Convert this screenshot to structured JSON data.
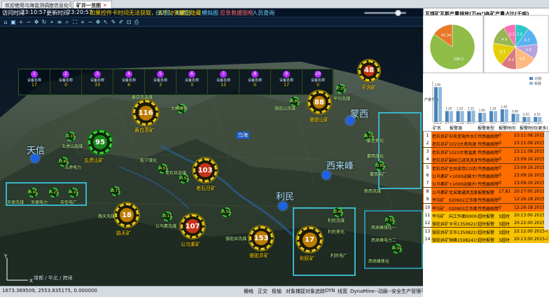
{
  "tabs": [
    {
      "label": "欢迎使用乌海监测调度信息化平台",
      "active": false
    },
    {
      "label": "矿井一览图",
      "active": true
    }
  ],
  "header": {
    "visit_time_label": "访问时间",
    "visit_time": "23:10:57",
    "update_time_label": "更新时间",
    "update_time": "23:20:57",
    "notice": "如果控件卡时间无法获取，请手动安装",
    "install_hint": "(32位、64位)",
    "hide_label": "!按钮隐藏",
    "link1": "模拟图",
    "link2": "应急救援图框",
    "personnel": "人员查询"
  },
  "toolbar_icons": [
    "home-icon",
    "save-icon",
    "zoom-in-icon",
    "zoom-out-icon",
    "pan-icon",
    "refresh-icon",
    "measure-icon",
    "layer-icon",
    "search-icon",
    "fullscreen-icon",
    "zoom-in-icon",
    "zoom-out-icon",
    "pan-icon",
    "select-icon",
    "tool-icon",
    "edit-icon",
    "zoom-box-icon",
    "print-icon"
  ],
  "top_strip": [
    {
      "pin": "1",
      "name": "设备名称",
      "value": "17"
    },
    {
      "pin": "2",
      "name": "设备名称",
      "value": "0"
    },
    {
      "pin": "3",
      "name": "设备名称",
      "value": "33"
    },
    {
      "pin": "4",
      "name": "设备名称",
      "value": "6"
    },
    {
      "pin": "5",
      "name": "设备名称",
      "value": "3"
    },
    {
      "pin": "6",
      "name": "设备名称",
      "value": "3"
    },
    {
      "pin": "7",
      "name": "设备名称",
      "value": "13"
    },
    {
      "pin": "8",
      "name": "设备名称",
      "value": "0"
    },
    {
      "pin": "9",
      "name": "设备名称",
      "value": "17"
    },
    {
      "pin": "10",
      "name": "设备名称",
      "value": "0"
    }
  ],
  "mines": [
    {
      "name": "黄白茨矿",
      "count": "116"
    },
    {
      "name": "五虎山矿",
      "count": "95"
    },
    {
      "name": "老石旦矿",
      "count": "103"
    },
    {
      "name": "骆驼山矿",
      "count": "88"
    },
    {
      "name": "平沟矿",
      "count": "48"
    },
    {
      "name": "路天矿",
      "count": "18"
    },
    {
      "name": "公乌素矿",
      "count": "107"
    },
    {
      "name": "骆驼井矿",
      "count": "153"
    },
    {
      "name": "利民矿",
      "count": "17"
    }
  ],
  "small_labels": [
    "大峡发电",
    "五虎山选煤",
    "五虎电力",
    "骆驼山洗煤",
    "平沟洗煤",
    "老石旦选煤",
    "乾宁煤化",
    "蒙西煤化",
    "蒙西电厂",
    "新西洗煤",
    "蒙达焦化",
    "黄白茨选煤",
    "天保洗煤",
    "天保电力",
    "天信电厂",
    "路天洗煤",
    "公乌素洗煤",
    "利民洗煤",
    "利民焦化",
    "利民电厂",
    "西来峰煤化一",
    "西来峰电力二",
    "西来峰焦化",
    "骆驼井洗煤"
  ],
  "places": [
    "天信",
    "蒙西",
    "西来峰",
    "利民",
    "乌海"
  ],
  "small_nodes": [
    "3.47",
    "2.15",
    "3.60",
    "6.80",
    "7.05",
    "3.52",
    "4.53",
    "6.19",
    "2.85",
    "5.23",
    "8.91",
    "4.10",
    "6.77",
    "3.13",
    "5.54",
    "2.46",
    "7.58",
    "4.92"
  ],
  "map_bottom": "煤都 / 华北 / 跨境",
  "status": {
    "coords": "1673.369509, 2553.835175, 0.000000",
    "items": [
      "栅格",
      "正交",
      "极轴",
      "对象捕捉",
      "对象追踪",
      "DYN",
      "线宽"
    ],
    "app": "DynaMine--动脉--安全生产管理平台"
  },
  "right_panel": {
    "pie1_title": "瓦煤矿瓦斯产量排放(万m³)",
    "pie2_title": "各矿产量占比(千吨)",
    "bar_legend": [
      "计划",
      "实际"
    ],
    "bar_ylabel": "产量千吨",
    "table_headers": [
      "矿名",
      "报警源",
      "报警类型",
      "报警时间",
      "报警时间(更多)"
    ],
    "more": "更多"
  },
  "chart_data": [
    {
      "type": "pie",
      "title": "瓦煤矿瓦斯产量排放(万m³)",
      "values": [
        230.3,
        41.34
      ],
      "labels": [
        "230.3",
        "41.34"
      ],
      "colors": [
        "#8fbd48",
        "#e8782a"
      ]
    },
    {
      "type": "pie",
      "title": "各矿产量占比(千吨)",
      "values": [
        3.6,
        4.7,
        3.9,
        5.6,
        4.2,
        6.1,
        4.9,
        3.1
      ],
      "labels": [
        "3.6",
        "4.7",
        "3.9",
        "5.6",
        "4.2",
        "6.1",
        "4.9",
        "3.1"
      ],
      "colors": [
        "#2ec7c9",
        "#5ab1ef",
        "#b6a2de",
        "#ffb980",
        "#d87a80",
        "#e5cf0d",
        "#97b552",
        "#ff6fb1"
      ]
    },
    {
      "type": "bar",
      "categories": [
        "骆驼井",
        "老石旦",
        "公乌素",
        "黄白茨",
        "利民",
        "平沟",
        "五虎山",
        "路天",
        "西来峰",
        "公乌素二"
      ],
      "series": [
        {
          "name": "计划",
          "values": [
            3.85,
            1.2,
            1.2,
            1.2,
            1.0,
            1.2,
            1.4,
            0.9,
            0.55,
            0.55
          ]
        },
        {
          "name": "实际",
          "values": [
            3.85,
            1.2,
            1.2,
            1.25,
            1.0,
            1.2,
            1.4,
            0.9,
            0.55,
            0.55
          ]
        }
      ],
      "data_labels": [
        "3.85",
        "1.20",
        "1.20",
        "1.25",
        "1.00",
        "1.20",
        "1.40",
        "0.90",
        "0.55",
        "0.55"
      ],
      "ylabel": "产量千吨",
      "ylim": [
        0,
        4.5
      ]
    }
  ],
  "alarms": [
    {
      "n": "1",
      "mine": "老石旦矿",
      "src": "中央变电所水位开关",
      "type": "传感器故障",
      "cnt": "0",
      "time": "23:11:08 2015-03"
    },
    {
      "n": "2",
      "mine": "老石旦矿",
      "src": "1023大巷风速",
      "type": "传感器故障",
      "cnt": "0",
      "time": "23:11:08 2015-03"
    },
    {
      "n": "3",
      "mine": "老石旦矿",
      "src": "1023大巷温度",
      "type": "传感器故障",
      "cnt": "0",
      "time": "23:11:08 2015-03"
    },
    {
      "n": "4",
      "mine": "老石旦矿",
      "src": "副井口进风风速温度",
      "type": "传感器故障",
      "cnt": "0",
      "time": "23:09:16 2015-03"
    },
    {
      "n": "5",
      "mine": "老石旦矿",
      "src": "主井皮带CO浓度",
      "type": "传感器故障",
      "cnt": "0",
      "time": "23:09:16 2015-03"
    },
    {
      "n": "6",
      "mine": "公乌素矿",
      "src": "+1000运输大巷工作面",
      "type": "传感器故障",
      "cnt": "0",
      "time": "23:09:16 2015-03"
    },
    {
      "n": "7",
      "mine": "公乌素矿",
      "src": "+1000运输大巷回风",
      "type": "传感器故障",
      "cnt": "0",
      "time": "23:09:16 2015-03"
    },
    {
      "n": "8",
      "mine": "公乌素矿",
      "src": "北采面通风瓦斯(主",
      "type": "报警报警",
      "cnt": "17.81",
      "time": "20:27:00 2015-03"
    },
    {
      "n": "9",
      "mine": "平沟矿",
      "src": "020902工作面回风",
      "type": "传感器故障",
      "cnt": "0",
      "time": "12:26:18 2015-03"
    },
    {
      "n": "10",
      "mine": "平沟矿",
      "src": "020903工作面后风",
      "type": "传感器故障",
      "cnt": "0",
      "time": "12:26:18 2015-03"
    },
    {
      "n": "11",
      "mine": "平沟矿",
      "src": "向工作面000000000",
      "type": "超时报警",
      "cnt": "3超时",
      "time": "20:13:00 2015-03"
    },
    {
      "n": "12",
      "mine": "骆驼井矿",
      "src": "卡号13506219832",
      "type": "超时报警",
      "cnt": "3超时",
      "time": "20:22:00 2015-03"
    },
    {
      "n": "13",
      "mine": "骆驼井矿",
      "src": "王华13508219832",
      "type": "超时报警",
      "cnt": "3超时",
      "time": "22:12:00 2015-03"
    },
    {
      "n": "14",
      "mine": "骆驼井矿",
      "src": "钟峰150824197402",
      "type": "超时报警",
      "cnt": "3超时",
      "time": "20:13:00 2015-03"
    }
  ]
}
